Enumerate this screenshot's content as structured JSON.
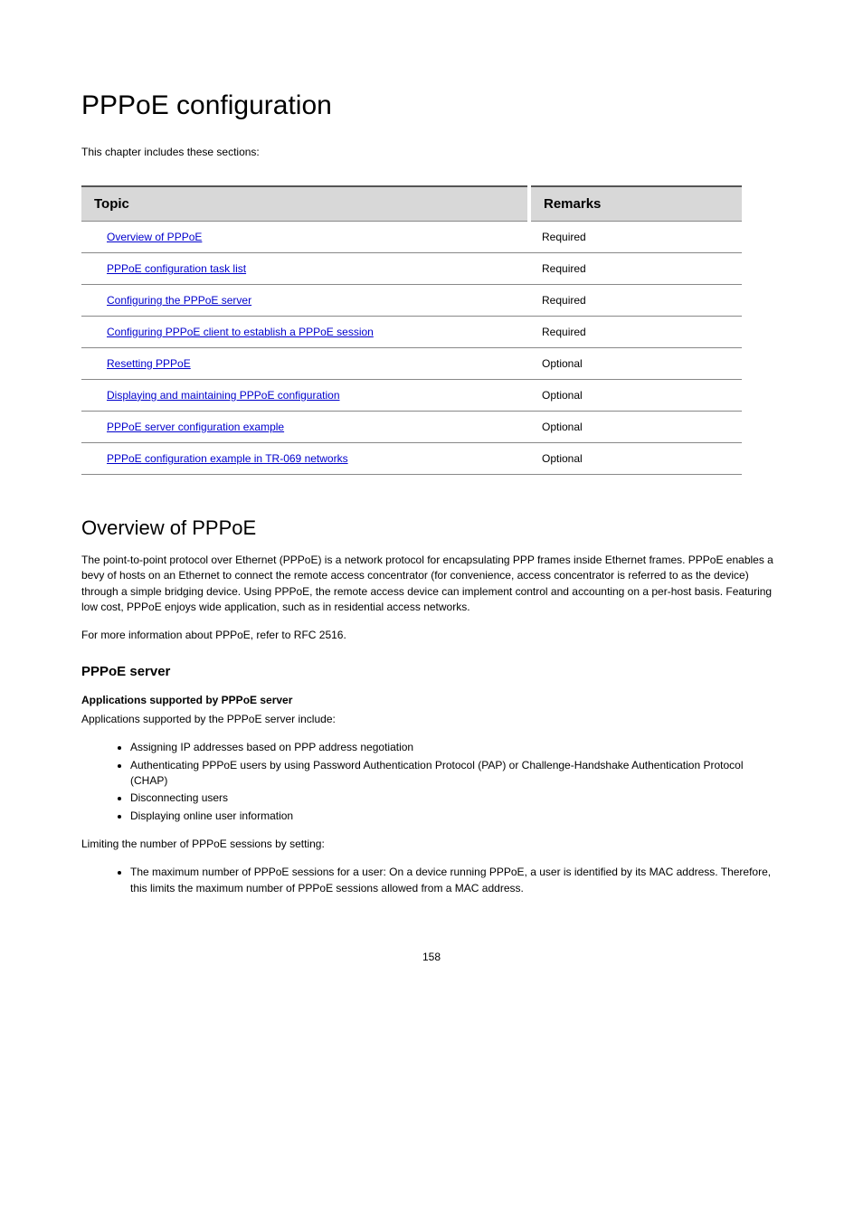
{
  "page_title": "PPPoE configuration",
  "intro_paragraph": "This chapter includes these sections:",
  "table": {
    "headers": {
      "topic": "Topic",
      "remarks": "Remarks"
    },
    "rows": [
      {
        "topic": "Overview of PPPoE",
        "remarks": "Required"
      },
      {
        "topic": "PPPoE configuration task list",
        "remarks": "Required"
      },
      {
        "topic": "Configuring the PPPoE server",
        "remarks": "Required"
      },
      {
        "topic": "Configuring PPPoE client to establish a PPPoE session",
        "remarks": "Required"
      },
      {
        "topic": "Resetting PPPoE",
        "remarks": "Optional"
      },
      {
        "topic": "Displaying and maintaining PPPoE configuration",
        "remarks": "Optional"
      },
      {
        "topic": "PPPoE server configuration example",
        "remarks": "Optional"
      },
      {
        "topic": "PPPoE configuration example in TR-069 networks",
        "remarks": "Optional"
      }
    ]
  },
  "overview": {
    "heading": "Overview of PPPoE",
    "p1": "The point-to-point protocol over Ethernet (PPPoE) is a network protocol for encapsulating PPP frames inside Ethernet frames. PPPoE enables a bevy of hosts on an Ethernet to connect the remote access concentrator (for convenience, access concentrator is referred to as the device) through a simple bridging device. Using PPPoE, the remote access device can implement control and accounting on a per-host basis. Featuring low cost, PPPoE enjoys wide application, such as in residential access networks.",
    "p2": "For more information about PPPoE, refer to RFC 2516."
  },
  "pppoe_server": {
    "heading": "PPPoE server",
    "subheading": "Applications supported by PPPoE server",
    "intro_line": "Applications supported by the PPPoE server include:",
    "bullets1": [
      "Assigning IP addresses based on PPP address negotiation",
      "Authenticating PPPoE users by using Password Authentication Protocol (PAP) or Challenge-Handshake Authentication Protocol (CHAP)",
      "Disconnecting users",
      "Displaying online user information"
    ],
    "limiting_intro": "Limiting the number of PPPoE sessions by setting:",
    "bullets2": [
      "The maximum number of PPPoE sessions for a user: On a device running PPPoE, a user is identified by its MAC address. Therefore, this limits the maximum number of PPPoE sessions allowed from a MAC address."
    ]
  },
  "page_number": "158"
}
